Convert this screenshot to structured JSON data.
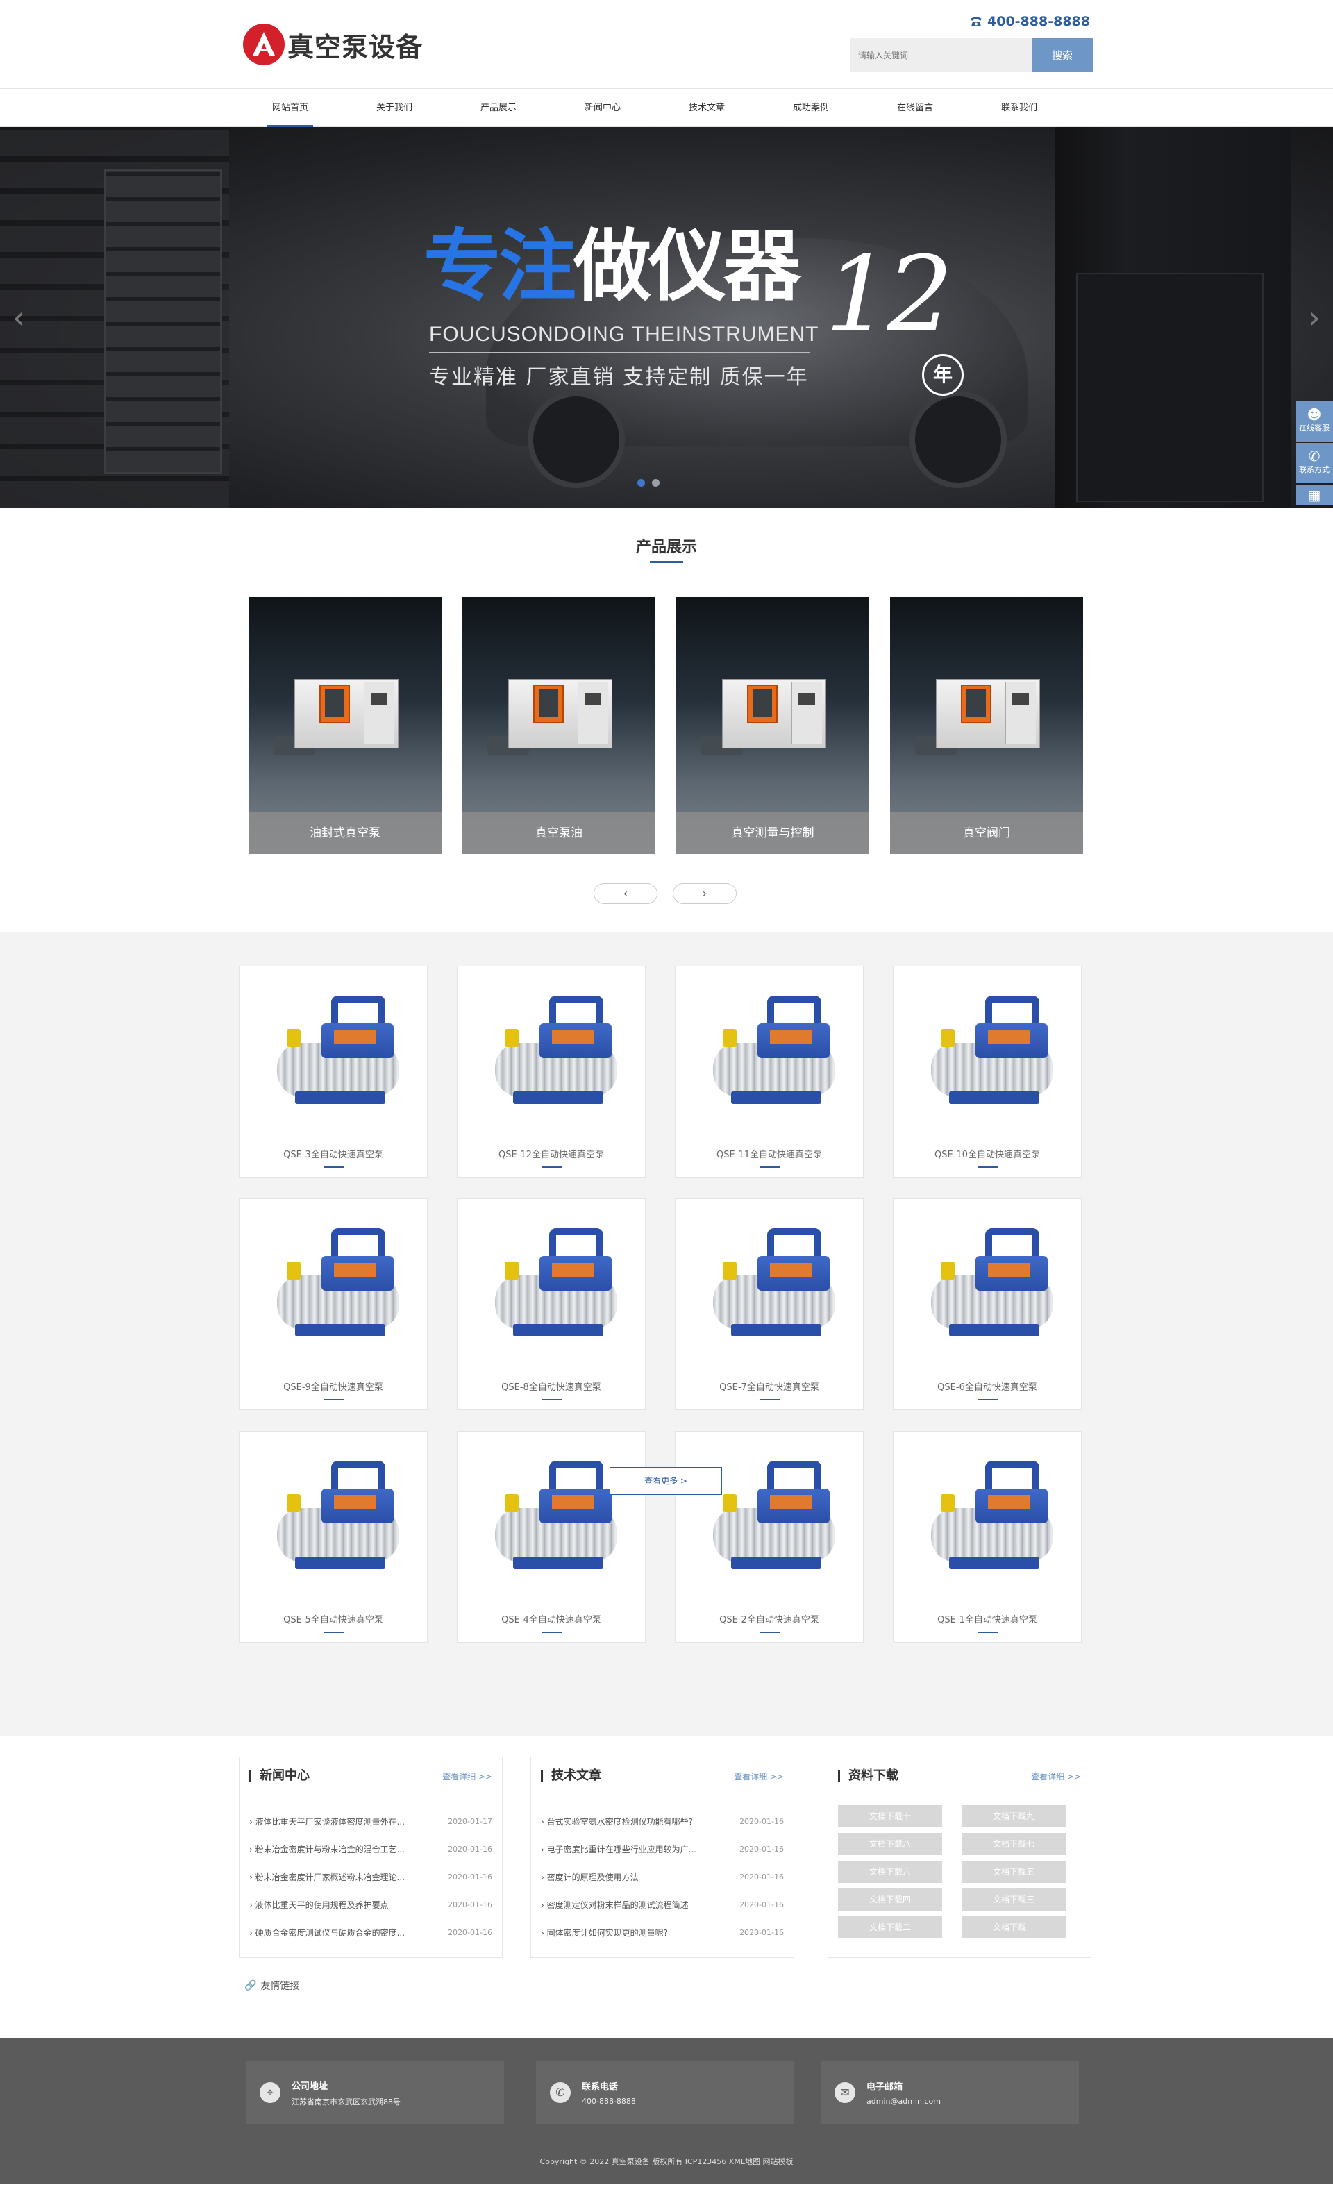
{
  "header": {
    "logo_text": "真空泵设备",
    "phone": "400-888-8888",
    "search_placeholder": "请输入关键词",
    "search_button": "搜索"
  },
  "nav": {
    "items": [
      "网站首页",
      "关于我们",
      "产品展示",
      "新闻中心",
      "技术文章",
      "成功案例",
      "在线留言",
      "联系我们"
    ]
  },
  "banner": {
    "slogan_blue": "专注",
    "slogan_white": "做仪器",
    "slogan_number": "12",
    "slogan_en": "FOUCUSONDOING THEINSTRUMENT",
    "slogan_sub": "专业精准 厂家直销 支持定制 质保一年",
    "slogan_year": "年",
    "prev_arrow": "‹",
    "next_arrow": "›",
    "side_tools": [
      "在线客服",
      "联系方式"
    ]
  },
  "showcase": {
    "title": "产品展示",
    "cards": [
      "油封式真空泵",
      "真空泵油",
      "真空测量与控制",
      "真空阀门"
    ],
    "prev": "‹",
    "next": "›"
  },
  "products": {
    "items": [
      "QSE-3全自动快速真空泵",
      "QSE-12全自动快速真空泵",
      "QSE-11全自动快速真空泵",
      "QSE-10全自动快速真空泵",
      "QSE-9全自动快速真空泵",
      "QSE-8全自动快速真空泵",
      "QSE-7全自动快速真空泵",
      "QSE-6全自动快速真空泵",
      "QSE-5全自动快速真空泵",
      "QSE-4全自动快速真空泵",
      "QSE-2全自动快速真空泵",
      "QSE-1全自动快速真空泵"
    ],
    "more": "查看更多 >"
  },
  "news": {
    "title": "新闻中心",
    "more": "查看详细 >>",
    "items": [
      {
        "text": "› 液体比重天平厂家谈液体密度测量外在...",
        "date": "2020-01-17"
      },
      {
        "text": "› 粉末冶金密度计与粉末冶金的混合工艺...",
        "date": "2020-01-16"
      },
      {
        "text": "› 粉末冶金密度计厂家概述粉末冶金理论...",
        "date": "2020-01-16"
      },
      {
        "text": "› 液体比重天平的使用规程及养护要点",
        "date": "2020-01-16"
      },
      {
        "text": "› 硬质合金密度测试仪与硬质合金的密度...",
        "date": "2020-01-16"
      }
    ]
  },
  "articles": {
    "title": "技术文章",
    "more": "查看详细 >>",
    "items": [
      {
        "text": "› 台式实验室氨水密度检测仪功能有哪些?",
        "date": "2020-01-16"
      },
      {
        "text": "› 电子密度比重计在哪些行业应用较为广...",
        "date": "2020-01-16"
      },
      {
        "text": "› 密度计的原理及使用方法",
        "date": "2020-01-16"
      },
      {
        "text": "› 密度测定仪对粉末样品的测试流程简述",
        "date": "2020-01-16"
      },
      {
        "text": "› 固体密度计如何实现更的测量呢?",
        "date": "2020-01-16"
      }
    ]
  },
  "downloads": {
    "title": "资料下载",
    "more": "查看详细 >>",
    "items": [
      "文档下载十",
      "文档下载九",
      "文档下载八",
      "文档下载七",
      "文档下载六",
      "文档下载五",
      "文档下载四",
      "文档下载三",
      "文档下载二",
      "文档下载一"
    ]
  },
  "links_label": "友情链接",
  "footer": {
    "address_label": "公司地址",
    "address": "江苏省南京市玄武区玄武湖88号",
    "phone_label": "联系电话",
    "phone": "400-888-8888",
    "email_label": "电子邮箱",
    "email": "admin@admin.com",
    "copyright": "Copyright © 2022 真空泵设备 版权所有 ICP123456 XML地图 网站模板"
  },
  "colors": {
    "brand_blue": "#2e5d9e",
    "accent_blue": "#6e96c6",
    "logo_red": "#d4202a",
    "footer_bg": "#5b5b5b"
  }
}
